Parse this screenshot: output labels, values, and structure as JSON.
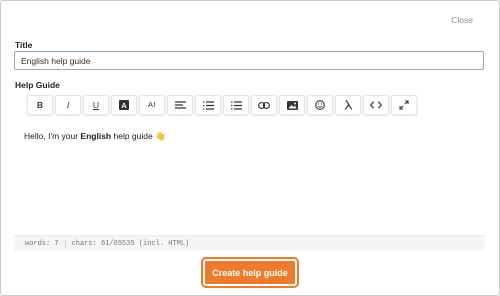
{
  "dialog": {
    "close_label": "Close",
    "title_label": "Title",
    "title_value": "English help guide",
    "help_label": "Help Guide",
    "submit_label": "Create help guide",
    "accent_color": "#ed7b2b"
  },
  "toolbar": {
    "bold": "B",
    "italic": "I",
    "underline": "U",
    "font_color": "A",
    "font_size": "AI",
    "tools": [
      "bold-icon",
      "italic-icon",
      "underline-icon",
      "font-color-icon",
      "font-size-icon",
      "align-icon",
      "ordered-list-icon",
      "unordered-list-icon",
      "link-icon",
      "image-icon",
      "emoji-icon",
      "formula-icon",
      "code-view-icon",
      "fullscreen-icon"
    ]
  },
  "content": {
    "prefix": "Hello, I'm your ",
    "bold": "English",
    "suffix": " help guide ",
    "emoji": "👋"
  },
  "status": {
    "words": "words: 7",
    "chars": "chars: 61/65535 (incl. HTML)"
  }
}
